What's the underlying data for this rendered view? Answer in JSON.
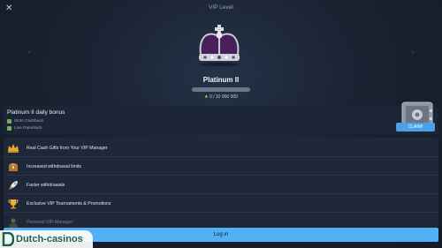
{
  "header": {
    "title": "VIP Level",
    "close_icon": "close-icon"
  },
  "nav": {
    "prev_glyph": "‹",
    "next_glyph": "›"
  },
  "level": {
    "name": "Platinum II",
    "progress_fraction": 0.0,
    "points_text": "0 / 10 000 000",
    "star_glyph": "★"
  },
  "bonus": {
    "title": "Platinum II daily bonus",
    "items": [
      "Slots Cashback",
      "Live Rakeback"
    ],
    "claim_label": "CLAIM!"
  },
  "benefits": [
    {
      "label": "Real Cash Gifts from Your VIP Manager",
      "icon": "crown-gift-icon"
    },
    {
      "label": "Increased withdrawal limits",
      "icon": "treasure-chest-icon"
    },
    {
      "label": "Faster withdrawals",
      "icon": "rocket-icon"
    },
    {
      "label": "Exclusive VIP Tournaments & Promotions",
      "icon": "trophy-icon"
    },
    {
      "label": "Personal VIP-Manager",
      "icon": "manager-icon"
    }
  ],
  "login": {
    "label": "Log in"
  },
  "watermark": {
    "text": "Dutch-casinos"
  },
  "colors": {
    "accent": "#52b0f6",
    "background": "#1a2232",
    "card": "#1f2838",
    "crown_velvet": "#4a1f5c",
    "star": "#f3c23a"
  }
}
